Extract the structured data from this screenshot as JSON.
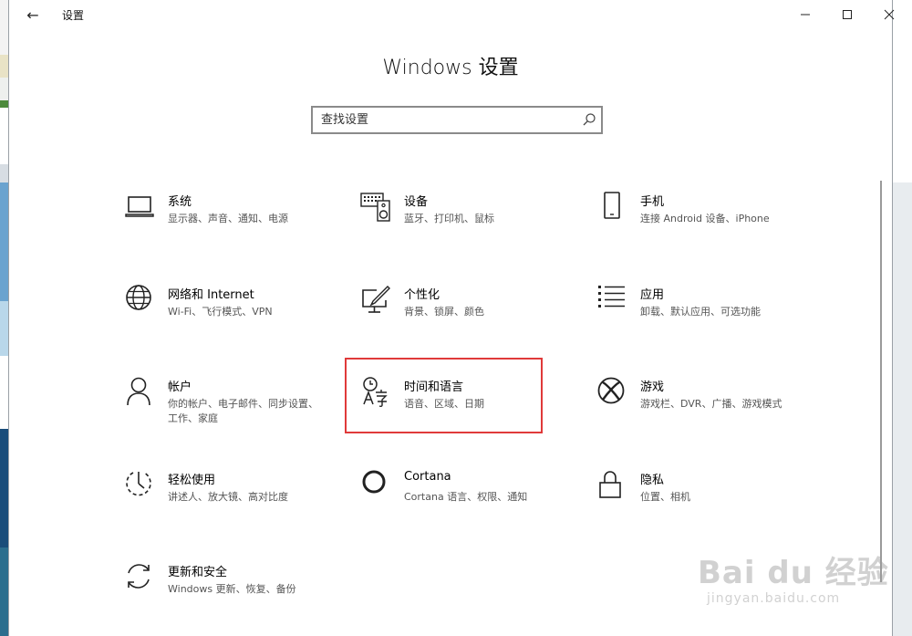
{
  "window": {
    "title": "设置",
    "back_glyph": "←",
    "min_glyph": "—",
    "max_glyph": "☐",
    "close_glyph": "✕"
  },
  "heading": "Windows 设置",
  "search": {
    "placeholder": "查找设置"
  },
  "tiles": [
    {
      "icon": "laptop-icon",
      "title": "系统",
      "subtitle": "显示器、声音、通知、电源"
    },
    {
      "icon": "keyboard-speaker-icon",
      "title": "设备",
      "subtitle": "蓝牙、打印机、鼠标"
    },
    {
      "icon": "phone-icon",
      "title": "手机",
      "subtitle": "连接 Android 设备、iPhone"
    },
    {
      "icon": "globe-icon",
      "title": "网络和 Internet",
      "subtitle": "Wi-Fi、飞行模式、VPN"
    },
    {
      "icon": "paint-monitor-icon",
      "title": "个性化",
      "subtitle": "背景、锁屏、颜色"
    },
    {
      "icon": "app-list-icon",
      "title": "应用",
      "subtitle": "卸载、默认应用、可选功能"
    },
    {
      "icon": "person-icon",
      "title": "帐户",
      "subtitle": "你的帐户、电子邮件、同步设置、工作、家庭"
    },
    {
      "icon": "time-language-icon",
      "title": "时间和语言",
      "subtitle": "语音、区域、日期"
    },
    {
      "icon": "xbox-icon",
      "title": "游戏",
      "subtitle": "游戏栏、DVR、广播、游戏模式"
    },
    {
      "icon": "ease-of-access-icon",
      "title": "轻松使用",
      "subtitle": "讲述人、放大镜、高对比度"
    },
    {
      "icon": "cortana-icon",
      "title": "Cortana",
      "subtitle": "Cortana 语言、权限、通知"
    },
    {
      "icon": "lock-icon",
      "title": "隐私",
      "subtitle": "位置、相机"
    },
    {
      "icon": "sync-icon",
      "title": "更新和安全",
      "subtitle": "Windows 更新、恢复、备份"
    }
  ],
  "watermark": {
    "brand": "Bai du 经验",
    "url": "jingyan.baidu.com"
  }
}
